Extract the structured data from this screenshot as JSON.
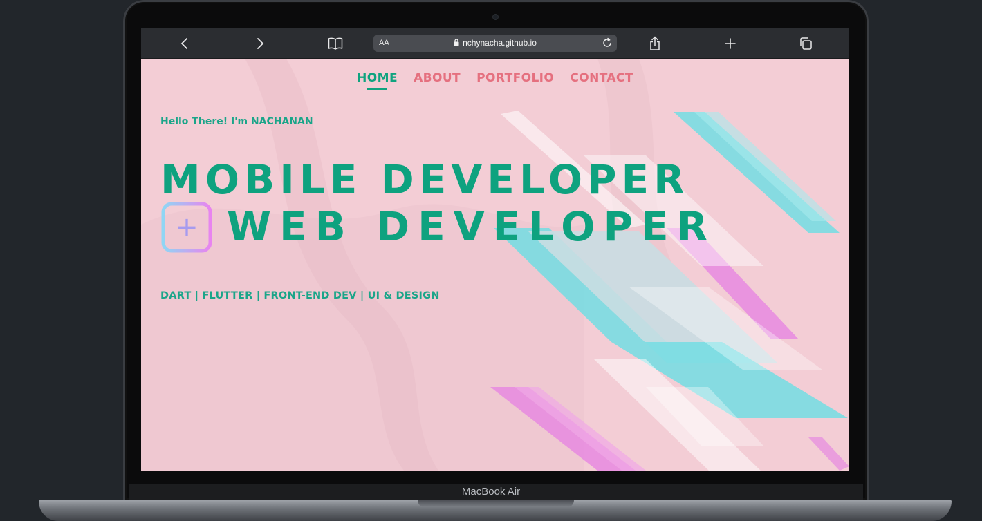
{
  "browser": {
    "text_size_label": "AA",
    "url": "nchynacha.github.io"
  },
  "nav": {
    "items": [
      {
        "label": "HOME",
        "active": true
      },
      {
        "label": "ABOUT",
        "active": false
      },
      {
        "label": "PORTFOLIO",
        "active": false
      },
      {
        "label": "CONTACT",
        "active": false
      }
    ]
  },
  "hero": {
    "greeting": "Hello There! I'm NACHANAN",
    "headline_line1": "MOBILE DEVELOPER",
    "headline_line2": "WEB DEVELOPER",
    "plus_symbol": "+",
    "tags": "DART | FLUTTER | FRONT-END DEV | UI & DESIGN"
  },
  "device": {
    "model_label": "MacBook Air"
  },
  "colors": {
    "accent_green": "#0ea27f",
    "nav_pink": "#e5707f",
    "page_background": "#f3cdd5",
    "toolbar": "#2b2d31"
  },
  "icons": {
    "back": "chevron-left-icon",
    "forward": "chevron-right-icon",
    "bookmarks": "book-icon",
    "lock": "lock-icon",
    "reload": "reload-icon",
    "share": "share-icon",
    "new_tab": "plus-icon",
    "tabs": "tabs-icon"
  }
}
